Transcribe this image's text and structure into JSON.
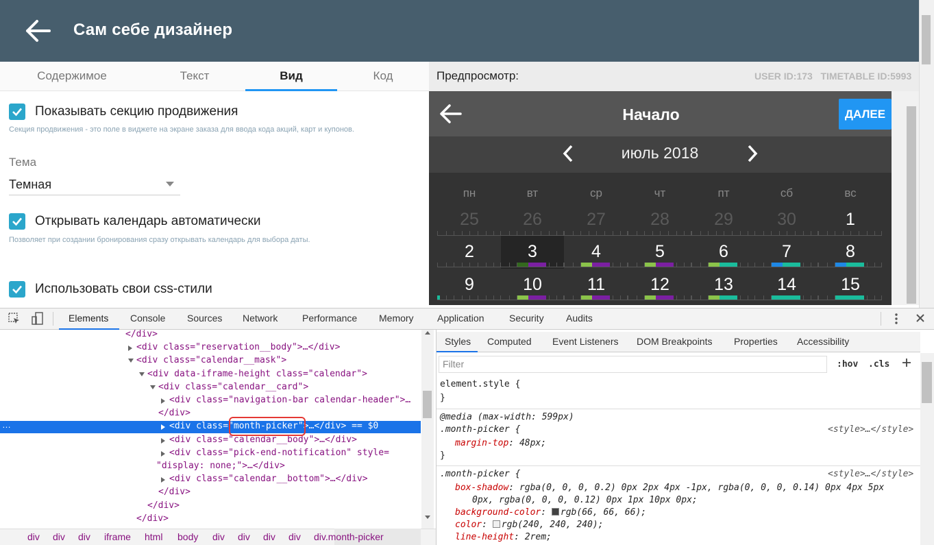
{
  "app": {
    "title": "Сам себе дизайнер"
  },
  "editor_tabs": [
    {
      "label": "Содержимое",
      "active": false
    },
    {
      "label": "Текст",
      "active": false
    },
    {
      "label": "Вид",
      "active": true
    },
    {
      "label": "Код",
      "active": false
    }
  ],
  "preview": {
    "label": "Предпросмотр:",
    "ids": "USER ID:173   TIMETABLE ID:5993"
  },
  "settings": {
    "promo": {
      "label": "Показывать секцию продвижения",
      "checked": true,
      "hint": "Секция продвижения - это поле в виджете на экране заказа для ввода кода акций, карт и купонов."
    },
    "theme": {
      "label": "Тема",
      "value": "Темная"
    },
    "autocal": {
      "label": "Открывать календарь автоматически",
      "checked": true,
      "hint": "Позволяет при создании бронирования сразу открывать календарь для выбора даты."
    },
    "css": {
      "label": "Использовать свои css-стили",
      "checked": true
    }
  },
  "calendar": {
    "title": "Начало",
    "next_label": "ДАЛЕЕ",
    "month": "июль 2018",
    "weekdays": [
      "пн",
      "вт",
      "ср",
      "чт",
      "пт",
      "сб",
      "вс"
    ],
    "rows": [
      [
        "25",
        "26",
        "27",
        "28",
        "29",
        "30",
        "1"
      ],
      [
        "2",
        "3",
        "4",
        "5",
        "6",
        "7",
        "8"
      ],
      [
        "9",
        "10",
        "11",
        "12",
        "13",
        "14",
        "15"
      ]
    ],
    "muted_row0": [
      true,
      true,
      true,
      true,
      true,
      true,
      false
    ],
    "today_day": "3",
    "colors": {
      "green": "#8bc34a",
      "purple": "#7b1fa2",
      "teal": "#1abc9c",
      "dark_green": "#33691e",
      "blue": "#1e88e5"
    }
  },
  "devtools": {
    "tabs": [
      "Elements",
      "Console",
      "Sources",
      "Network",
      "Performance",
      "Memory",
      "Application",
      "Security",
      "Audits"
    ],
    "active_tab": "Elements",
    "dom_lines": [
      {
        "text": "</div>"
      },
      {
        "text": "<div class=\"reservation__body\">…</div>"
      },
      {
        "text": "<div class=\"calendar__mask\">"
      },
      {
        "text": "<div data-iframe-height class=\"calendar\">"
      },
      {
        "text": "<div class=\"calendar__card\">"
      },
      {
        "text": "<div class=\"navigation-bar calendar-header\">…"
      },
      {
        "text": "</div>"
      },
      {
        "text": "<div class=\"month-picker\">…</div> == $0"
      },
      {
        "text": "<div class=\"calendar__body\">…</div>"
      },
      {
        "text": "<div class=\"pick-end-notification\" style="
      },
      {
        "text": "\"display: none;\">…</div>"
      },
      {
        "text": "<div class=\"calendar__bottom\">…</div>"
      },
      {
        "text": "</div>"
      },
      {
        "text": "</div>"
      },
      {
        "text": "</div>"
      }
    ],
    "breadcrumbs": [
      "div",
      "div",
      "div",
      "iframe",
      "html",
      "body",
      "div",
      "div",
      "div",
      "div",
      "div.month-picker"
    ],
    "styles_tabs": [
      "Styles",
      "Computed",
      "Event Listeners",
      "DOM Breakpoints",
      "Properties",
      "Accessibility"
    ],
    "filter_placeholder": "Filter",
    "hov": ":hov",
    "cls": ".cls",
    "rules": {
      "element_style": "element.style {",
      "close": "}",
      "media": "@media (max-width: 599px)",
      "selector": ".month-picker {",
      "source": "<style>…</style>",
      "margin_top": "margin-top",
      "margin_top_val": "48px;",
      "box_shadow": "box-shadow",
      "box_shadow_val1": "rgba(0, 0, 0, 0.2) 0px 2px 4px -1px, rgba(0, 0, 0, 0.14) 0px 4px 5px",
      "box_shadow_val2": "0px, rgba(0, 0, 0, 0.12) 0px 1px 10px 0px;",
      "bg_color": "background-color",
      "bg_color_val": "rgb(66, 66, 66);",
      "color": "color",
      "color_val": "rgb(240, 240, 240);",
      "line_height": "line-height",
      "line_height_val": "2rem;"
    }
  }
}
